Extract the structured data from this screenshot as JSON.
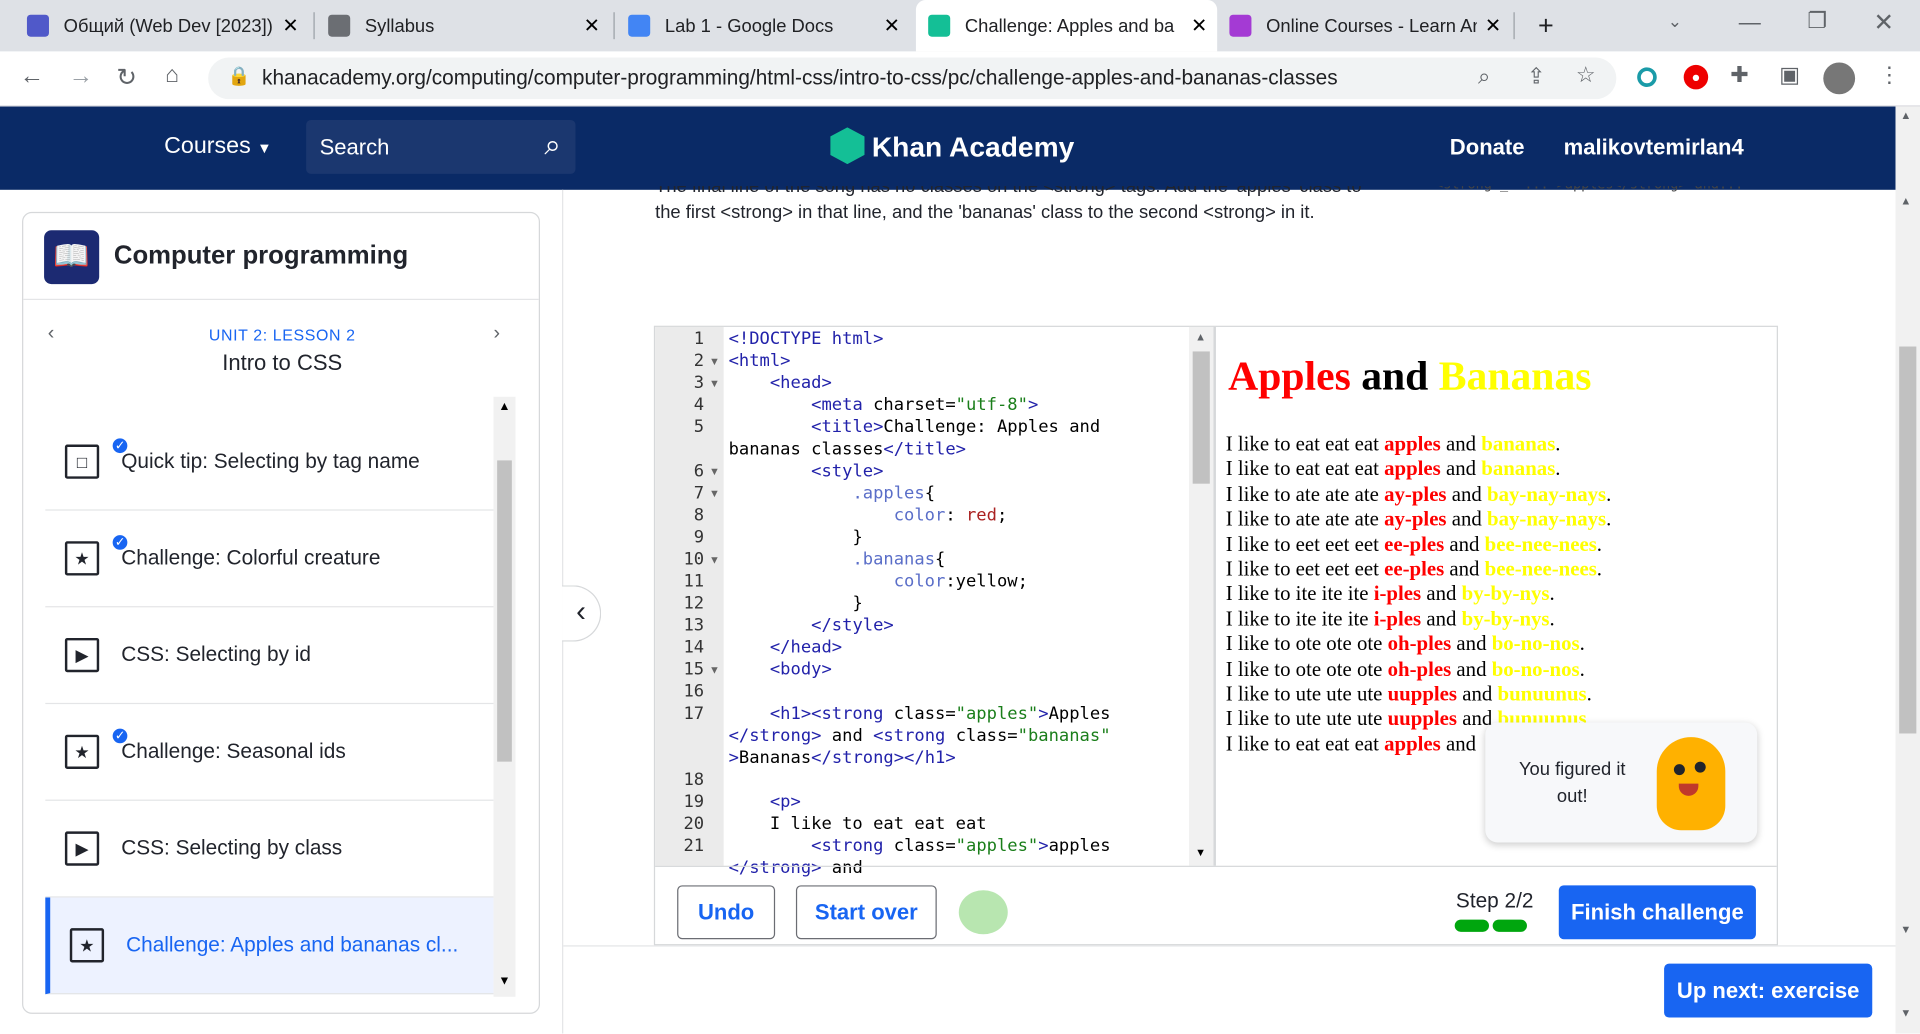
{
  "tabs": [
    {
      "title": "Общий (Web Dev [2023])",
      "color": "#5059c9"
    },
    {
      "title": "Syllabus",
      "color": "#6b6e73"
    },
    {
      "title": "Lab 1 - Google Docs",
      "color": "#4285f4"
    },
    {
      "title": "Challenge: Apples and ba",
      "color": "#14bf96"
    },
    {
      "title": "Online Courses - Learn Ar",
      "color": "#a43ad4"
    }
  ],
  "address": {
    "url": "khanacademy.org/computing/computer-programming/html-css/intro-to-css/pc/challenge-apples-and-bananas-classes"
  },
  "nav": {
    "courses": "Courses",
    "search": "Search",
    "brand": "Khan Academy",
    "donate": "Donate",
    "user": "malikovtemirlan4"
  },
  "course": {
    "title": "Computer programming",
    "unit": "UNIT 2: LESSON 2",
    "lesson": "Intro to CSS"
  },
  "items": [
    {
      "label": "Quick tip: Selecting by tag name",
      "icon": "□",
      "done": true
    },
    {
      "label": "Challenge: Colorful creature",
      "icon": "★",
      "done": true
    },
    {
      "label": "CSS: Selecting by id",
      "icon": "▶",
      "done": false
    },
    {
      "label": "Challenge: Seasonal ids",
      "icon": "★",
      "done": true
    },
    {
      "label": "CSS: Selecting by class",
      "icon": "▶",
      "done": false
    },
    {
      "label": "Challenge: Apples and bananas cl...",
      "icon": "★",
      "done": false
    }
  ],
  "instructions": {
    "line1": "The final line of the song has no classes on the <strong> tags. Add the 'apples' class to",
    "line2": "the first <strong> in that line, and the 'bananas' class to the second <strong> in it.",
    "hint": "<strong _= ... >apples</strong> and..."
  },
  "code_lines": [
    {
      "n": "1",
      "html": "&lt;!DOCTYPE html&gt;",
      "fold": false
    },
    {
      "n": "2",
      "html": "<span class='tg'>&lt;html&gt;</span>",
      "fold": true
    },
    {
      "n": "3",
      "html": "    <span class='tg'>&lt;head&gt;</span>",
      "fold": true
    },
    {
      "n": "4",
      "html": "        <span class='tg'>&lt;meta</span> <span class='tx'>charset=</span><span class='st'>\"utf-8\"</span><span class='tg'>&gt;</span>",
      "fold": false
    },
    {
      "n": "5",
      "html": "        <span class='tg'>&lt;title&gt;</span><span class='tx'>Challenge: Apples and</span>",
      "fold": false
    },
    {
      "n": "",
      "html": "<span class='tx'>bananas classes</span><span class='tg'>&lt;/title&gt;</span>",
      "fold": false
    },
    {
      "n": "6",
      "html": "        <span class='tg'>&lt;style&gt;</span>",
      "fold": true
    },
    {
      "n": "7",
      "html": "            <span class='pr'>.apples</span><span class='tx'>{</span>",
      "fold": true
    },
    {
      "n": "8",
      "html": "                <span class='pr'>color</span><span class='tx'>: </span><span class='vl'>red</span><span class='tx'>;</span>",
      "fold": false
    },
    {
      "n": "9",
      "html": "            <span class='tx'>}</span>",
      "fold": false
    },
    {
      "n": "10",
      "html": "            <span class='pr'>.bananas</span><span class='tx'>{</span>",
      "fold": true
    },
    {
      "n": "11",
      "html": "                <span class='pr'>color</span><span class='tx'>:yellow;</span>",
      "fold": false
    },
    {
      "n": "12",
      "html": "            <span class='tx'>}</span>",
      "fold": false
    },
    {
      "n": "13",
      "html": "        <span class='tg'>&lt;/style&gt;</span>",
      "fold": false
    },
    {
      "n": "14",
      "html": "    <span class='tg'>&lt;/head&gt;</span>",
      "fold": false
    },
    {
      "n": "15",
      "html": "    <span class='tg'>&lt;body&gt;</span>",
      "fold": true
    },
    {
      "n": "16",
      "html": "",
      "fold": false
    },
    {
      "n": "17",
      "html": "    <span class='tg'>&lt;h1&gt;&lt;strong</span> <span class='tx'>class=</span><span class='st'>\"apples\"</span><span class='tg'>&gt;</span><span class='tx'>Apples</span>",
      "fold": false
    },
    {
      "n": "",
      "html": "<span class='tg'>&lt;/strong&gt;</span> <span class='tx'>and</span> <span class='tg'>&lt;strong</span> <span class='tx'>class=</span><span class='st'>\"bananas\"</span>",
      "fold": false
    },
    {
      "n": "",
      "html": "<span class='tg'>&gt;</span><span class='tx'>Bananas</span><span class='tg'>&lt;/strong&gt;&lt;/h1&gt;</span>",
      "fold": false
    },
    {
      "n": "18",
      "html": "",
      "fold": false
    },
    {
      "n": "19",
      "html": "    <span class='tg'>&lt;p&gt;</span>",
      "fold": false
    },
    {
      "n": "20",
      "html": "    <span class='tx'>I like to eat eat eat</span>",
      "fold": false
    },
    {
      "n": "21",
      "html": "        <span class='tg'>&lt;strong</span> <span class='tx'>class=</span><span class='st'>\"apples\"</span><span class='tg'>&gt;</span><span class='tx'>apples</span>",
      "fold": false
    },
    {
      "n": "",
      "html": "<span class='tg'>&lt;/strong&gt;</span> <span class='tx'>and</span>",
      "fold": false
    }
  ],
  "output": {
    "h1_a": "Apples",
    "h1_and": " and ",
    "h1_b": "Bananas",
    "lines": [
      [
        "I like to eat eat eat ",
        "apples",
        " and ",
        "bananas",
        "."
      ],
      [
        "I like to eat eat eat ",
        "apples",
        " and ",
        "bananas",
        "."
      ],
      [
        "I like to ate ate ate ",
        "ay-ples",
        " and ",
        "bay-nay-nays",
        "."
      ],
      [
        "I like to ate ate ate ",
        "ay-ples",
        " and ",
        "bay-nay-nays",
        "."
      ],
      [
        "I like to eet eet eet ",
        "ee-ples",
        " and ",
        "bee-nee-nees",
        "."
      ],
      [
        "I like to eet eet eet ",
        "ee-ples",
        " and ",
        "bee-nee-nees",
        "."
      ],
      [
        "I like to ite ite ite ",
        "i-ples",
        " and ",
        "by-by-nys",
        "."
      ],
      [
        "I like to ite ite ite ",
        "i-ples",
        " and ",
        "by-by-nys",
        "."
      ],
      [
        "I like to ote ote ote ",
        "oh-ples",
        " and ",
        "bo-no-nos",
        "."
      ],
      [
        "I like to ote ote ote ",
        "oh-ples",
        " and ",
        "bo-no-nos",
        "."
      ],
      [
        "I like to ute ute ute ",
        "uupples",
        " and ",
        "bunuunus",
        "."
      ],
      [
        "I like to ute ute ute ",
        "uupples",
        " and ",
        "bunuunus",
        "."
      ],
      [
        "I like to eat eat eat ",
        "apples",
        " and ",
        "",
        ""
      ]
    ]
  },
  "toast": {
    "text": "You figured it out!"
  },
  "actions": {
    "undo": "Undo",
    "start_over": "Start over",
    "step": "Step 2/2",
    "finish": "Finish challenge",
    "up_next": "Up next: exercise"
  }
}
